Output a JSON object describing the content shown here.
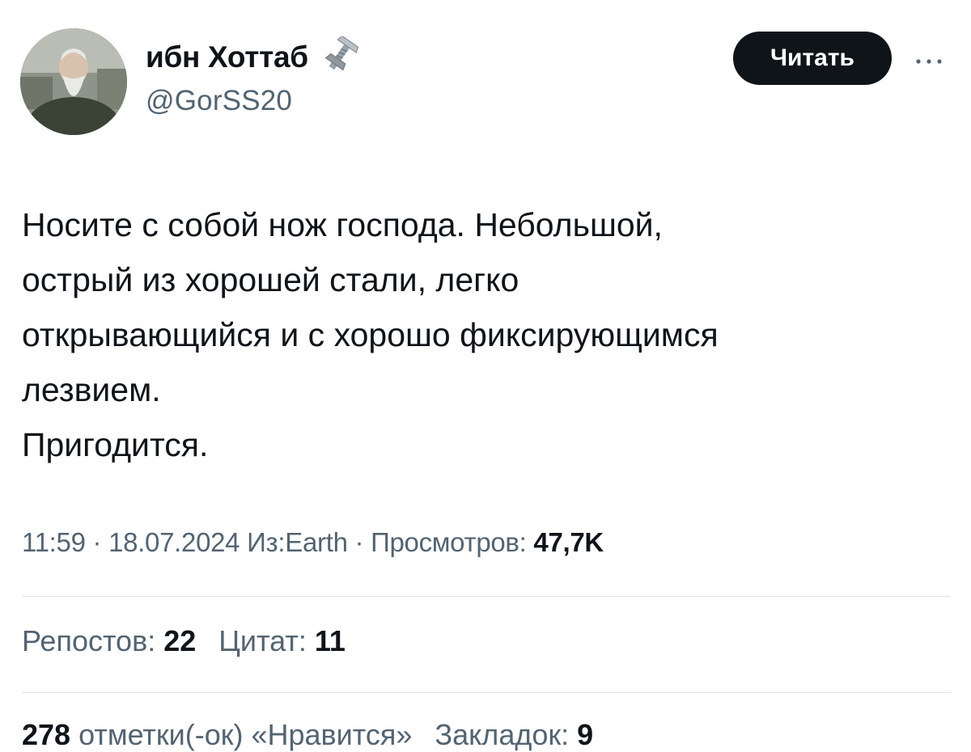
{
  "author": {
    "display_name": "ибн Хоттаб",
    "handle": "@GorSS20",
    "badge_icon": "bolt-nut-icon"
  },
  "follow_button": {
    "label": "Читать"
  },
  "more_icon": "more-horizontal-icon",
  "tweet": {
    "lines": [
      "Носите с собой нож господа. Небольшой,",
      "острый из хорошей стали, легко",
      "открывающийся и с хорошо фиксирующимся",
      "лезвием.",
      "Пригодится."
    ]
  },
  "meta": {
    "time": "11:59",
    "date": "18.07.2024",
    "source": "Из:Earth",
    "views_label": "Просмотров:",
    "views_value": "47,7K"
  },
  "stats": {
    "reposts_label": "Репостов:",
    "reposts_value": "22",
    "quotes_label": "Цитат:",
    "quotes_value": "11",
    "likes_value": "278",
    "likes_label": "отметки(-ок) «Нравится»",
    "bookmarks_label": "Закладок:",
    "bookmarks_value": "9"
  },
  "colors": {
    "text_primary": "#0f1419",
    "text_secondary": "#536471",
    "button_bg": "#0f1419",
    "divider": "#dde3e7"
  }
}
